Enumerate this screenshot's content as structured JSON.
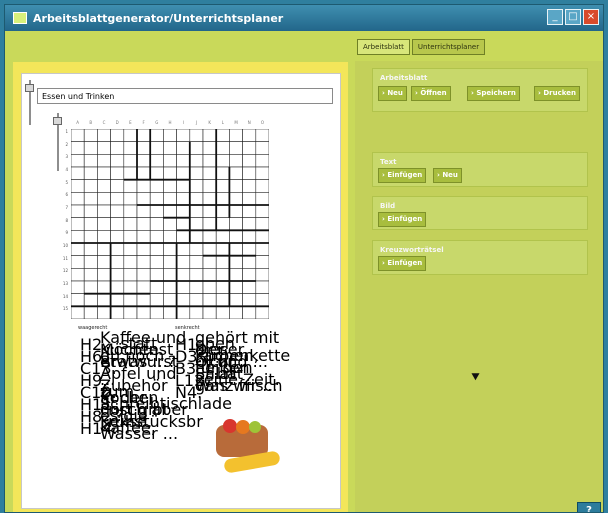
{
  "window": {
    "title": "Arbeitsblattgenerator/Unterrichtsplaner",
    "buttons": [
      "_",
      "□",
      "×"
    ]
  },
  "tabs": [
    "Arbeitsblatt",
    "Unterrichtsplaner"
  ],
  "sheet": {
    "title": "Essen und Trinken",
    "col_labels": [
      "A",
      "B",
      "C",
      "D",
      "E",
      "F",
      "G",
      "H",
      "I",
      "J",
      "K",
      "L",
      "M",
      "N",
      "O"
    ],
    "row_labels": [
      "1",
      "2",
      "3",
      "4",
      "5",
      "6",
      "7",
      "8",
      "9",
      "10",
      "11",
      "12",
      "13",
      "14",
      "15"
    ],
    "clues": {
      "horizontal_head": "waagerecht",
      "vertical_head": "senkrecht",
      "left": [
        {
          "num": "H2.",
          "text": "Kaffee und ... statt Kuchen"
        },
        {
          "num": "H6.",
          "text": "Möchtest du noch etwas ...?"
        },
        {
          "num": "C13.",
          "text": "Bratwurst"
        },
        {
          "num": "H9.",
          "text": "Apfel und ..."
        },
        {
          "num": "C10.",
          "text": "Zubehör zum Kochen"
        },
        {
          "num": "H11.",
          "text": "In der Schreibtischlade dort gibt es die Frühstücksbrote"
        },
        {
          "num": "H8.",
          "text": "Frisch aber ...?"
        },
        {
          "num": "H14.",
          "text": "Kekse, Kaffee, Wasser ..."
        }
      ],
      "right": [
        {
          "num": "H1.",
          "text": "gehört mit oben dieser Farbenkette"
        },
        {
          "num": "D3.",
          "text": "Der Kuchen, nicht heißen"
        },
        {
          "num": "B3.",
          "text": "Öl und ... für den Salat"
        },
        {
          "num": "L12.",
          "text": "Er hat keine Zeit. Was wir ..."
        },
        {
          "num": "N4.",
          "text": "ganz frisch"
        }
      ]
    }
  },
  "right_panel": {
    "groups": [
      {
        "title": "Arbeitsblatt",
        "buttons": [
          "Neu",
          "Öffnen",
          "Speichern",
          "Drucken"
        ]
      },
      {
        "title": "Text",
        "buttons": [
          "Einfügen",
          "Neu"
        ]
      },
      {
        "title": "Bild",
        "buttons": [
          "Einfügen"
        ]
      },
      {
        "title": "Kreuzworträtsel",
        "buttons": [
          "Einfügen"
        ]
      }
    ]
  },
  "help": {
    "label": "?"
  },
  "colors": {
    "window_bg": "#c9d95a",
    "sheet_frame": "#f3e65a",
    "titlebar": "#22668a",
    "button": "#a8bd3e"
  }
}
